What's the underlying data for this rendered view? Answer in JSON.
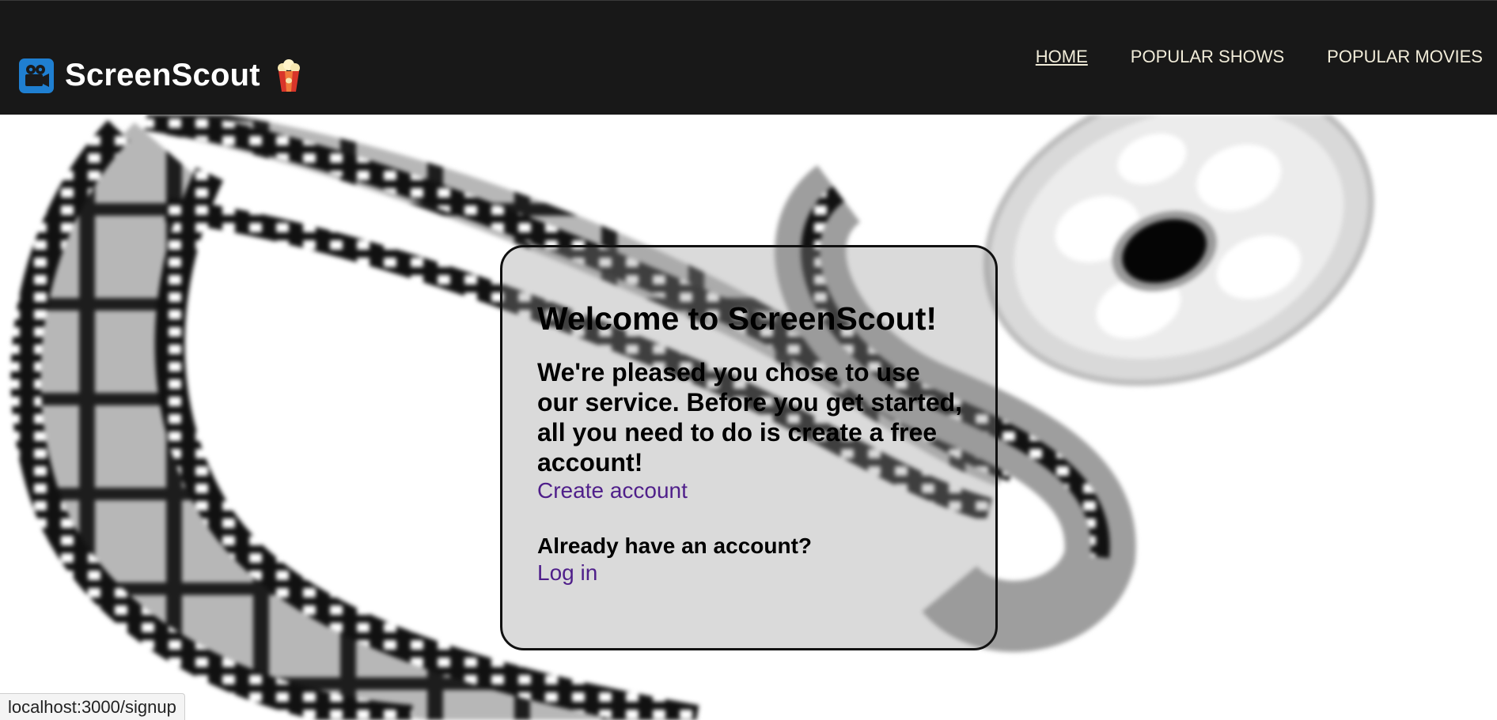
{
  "brand": {
    "title": "ScreenScout",
    "camera_icon": "movie-camera-icon",
    "popcorn_icon": "popcorn-icon"
  },
  "nav": {
    "items": [
      {
        "label": "HOME",
        "active": true
      },
      {
        "label": "POPULAR SHOWS",
        "active": false
      },
      {
        "label": "POPULAR MOVIES",
        "active": false
      }
    ]
  },
  "card": {
    "title": "Welcome to ScreenScout!",
    "lead": "We're pleased you chose to use our service. Before you get started, all you need to do is create a free account!",
    "create_link": "Create account",
    "already_text": "Already have an account?",
    "login_link": "Log in"
  },
  "status_bar": {
    "url": "localhost:3000/signup"
  },
  "colors": {
    "header_bg": "#181818",
    "nav_text": "#f1ecd9",
    "link": "#4f1f8a",
    "camera_tile": "#1f7fd1"
  }
}
